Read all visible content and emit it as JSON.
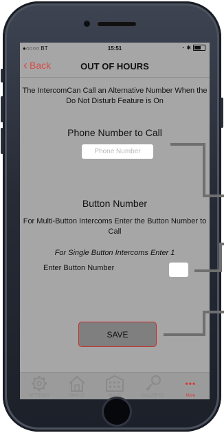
{
  "status_bar": {
    "carrier": "●○○○○ BT",
    "time": "15:51"
  },
  "nav": {
    "back_label": "Back",
    "title": "OUT OF HOURS"
  },
  "intro_text": "The IntercomCan Call an Alternative Number When the Do Not Disturb Feature is On",
  "phone_section": {
    "heading": "Phone Number to Call",
    "placeholder": "Phone Number"
  },
  "button_section": {
    "heading": "Button Number",
    "multi_text": "For Multi-Button Intercoms Enter the Button Number to Call",
    "single_text": "For Single Button Intercoms Enter 1",
    "enter_label": "Enter Button Number"
  },
  "save_label": "SAVE",
  "tabs": [
    {
      "label": "SETTINGS",
      "icon": "gear-icon"
    },
    {
      "label": "SINGLE",
      "icon": "house-icon"
    },
    {
      "label": "MULTI",
      "icon": "building-icon"
    },
    {
      "label": "CALLER ID",
      "icon": "key-icon"
    },
    {
      "label": "More",
      "icon": "more-dots-icon"
    }
  ],
  "colors": {
    "accent": "#d63a3a",
    "screen_bg": "#a6a6a6"
  }
}
